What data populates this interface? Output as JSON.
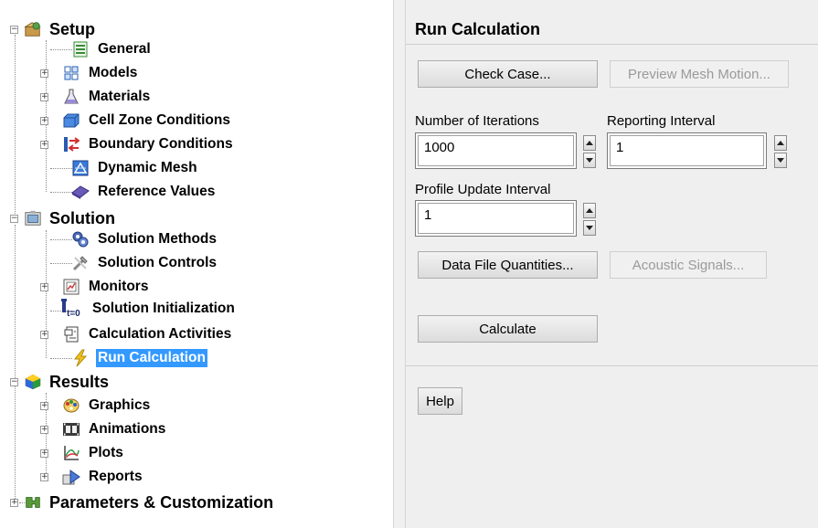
{
  "tree": {
    "setup": {
      "label": "Setup",
      "toggle": "−",
      "children": [
        {
          "label": "General",
          "icon": "general-icon"
        },
        {
          "label": "Models",
          "icon": "models-icon",
          "toggle": "+"
        },
        {
          "label": "Materials",
          "icon": "materials-icon",
          "toggle": "+"
        },
        {
          "label": "Cell Zone Conditions",
          "icon": "cell-zone-icon",
          "toggle": "+"
        },
        {
          "label": "Boundary Conditions",
          "icon": "boundary-icon",
          "toggle": "+"
        },
        {
          "label": "Dynamic Mesh",
          "icon": "dynamic-mesh-icon"
        },
        {
          "label": "Reference Values",
          "icon": "reference-values-icon"
        }
      ]
    },
    "solution": {
      "label": "Solution",
      "toggle": "−",
      "children": [
        {
          "label": "Solution Methods",
          "icon": "solution-methods-icon"
        },
        {
          "label": "Solution Controls",
          "icon": "solution-controls-icon"
        },
        {
          "label": "Monitors",
          "icon": "monitors-icon",
          "toggle": "+"
        },
        {
          "label": "Solution Initialization",
          "icon": "initialization-icon",
          "icon_text": "t=0"
        },
        {
          "label": "Calculation Activities",
          "icon": "calculation-activities-icon",
          "toggle": "+"
        },
        {
          "label": "Run Calculation",
          "icon": "run-calculation-icon",
          "selected": true
        }
      ]
    },
    "results": {
      "label": "Results",
      "toggle": "−",
      "children": [
        {
          "label": "Graphics",
          "icon": "graphics-icon",
          "toggle": "+"
        },
        {
          "label": "Animations",
          "icon": "animations-icon",
          "toggle": "+"
        },
        {
          "label": "Plots",
          "icon": "plots-icon",
          "toggle": "+"
        },
        {
          "label": "Reports",
          "icon": "reports-icon",
          "toggle": "+"
        }
      ]
    },
    "parameters": {
      "label": "Parameters & Customization",
      "toggle": "+"
    }
  },
  "panel": {
    "title": "Run Calculation",
    "check_case": "Check Case...",
    "preview_mesh_motion": "Preview Mesh Motion...",
    "iterations_label": "Number of Iterations",
    "iterations_value": "1000",
    "reporting_label": "Reporting Interval",
    "reporting_value": "1",
    "profile_label": "Profile Update Interval",
    "profile_value": "1",
    "data_file_quantities": "Data File Quantities...",
    "acoustic_signals": "Acoustic Signals...",
    "calculate": "Calculate",
    "help": "Help"
  },
  "colors": {
    "selection": "#3399ff",
    "panel_bg": "#efefef"
  }
}
